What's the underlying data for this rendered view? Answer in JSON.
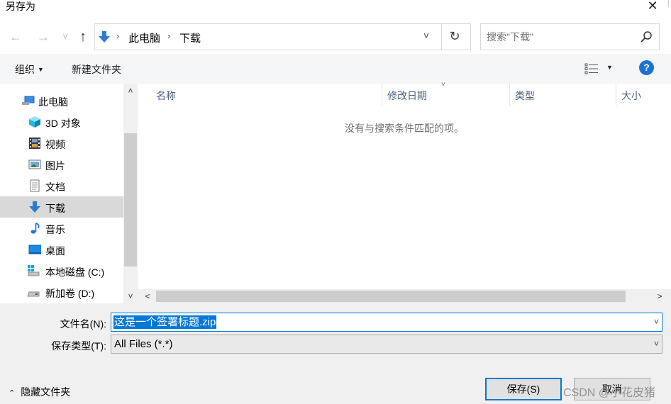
{
  "window": {
    "title": "另存为",
    "close_glyph": "✕"
  },
  "nav": {
    "back_glyph": "←",
    "forward_glyph": "→",
    "recent_glyph": "˅",
    "up_glyph": "↑",
    "breadcrumb": [
      "此电脑",
      "下载"
    ],
    "separator_glyph": "›",
    "dropdown_glyph": "˅",
    "refresh_glyph": "↻",
    "search_placeholder": "搜索\"下载\""
  },
  "toolbar": {
    "organize_label": "组织",
    "organize_caret": "▼",
    "new_folder_label": "新建文件夹",
    "view_caret": "▼",
    "help_glyph": "?"
  },
  "sidebar": {
    "items": [
      {
        "label": "此电脑",
        "icon": "computer-icon"
      },
      {
        "label": "3D 对象",
        "icon": "cube-3d-icon"
      },
      {
        "label": "视频",
        "icon": "film-icon"
      },
      {
        "label": "图片",
        "icon": "picture-icon"
      },
      {
        "label": "文档",
        "icon": "document-icon"
      },
      {
        "label": "下载",
        "icon": "download-icon",
        "selected": true
      },
      {
        "label": "音乐",
        "icon": "music-note-icon"
      },
      {
        "label": "桌面",
        "icon": "desktop-icon"
      },
      {
        "label": "本地磁盘 (C:)",
        "icon": "windows-drive-icon"
      },
      {
        "label": "新加卷 (D:)",
        "icon": "drive-icon"
      }
    ],
    "scroll_up_glyph": "˄",
    "scroll_down_glyph": "˅"
  },
  "file_list": {
    "columns": [
      "名称",
      "修改日期",
      "类型",
      "大小"
    ],
    "sort_caret": "˅",
    "empty_message": "没有与搜索条件匹配的项。",
    "scroll_left_glyph": "<",
    "scroll_right_glyph": ">"
  },
  "form": {
    "filename_label": "文件名(N):",
    "filename_value": "这是一个签署标题.zip",
    "filetype_label": "保存类型(T):",
    "filetype_value": "All Files (*.*)",
    "dropdown_glyph": "˅"
  },
  "footer": {
    "hide_folders_label": "隐藏文件夹",
    "hide_folders_caret": "⌃",
    "save_label": "保存(S)",
    "cancel_label": "取消",
    "watermark": "CSDN @小花皮猪"
  },
  "colors": {
    "accent": "#0078d7",
    "help": "#1a73d1",
    "selected_row": "#d9d9d9",
    "bottom_panel": "#f0f0f0",
    "column_header_text": "#4c607a"
  }
}
